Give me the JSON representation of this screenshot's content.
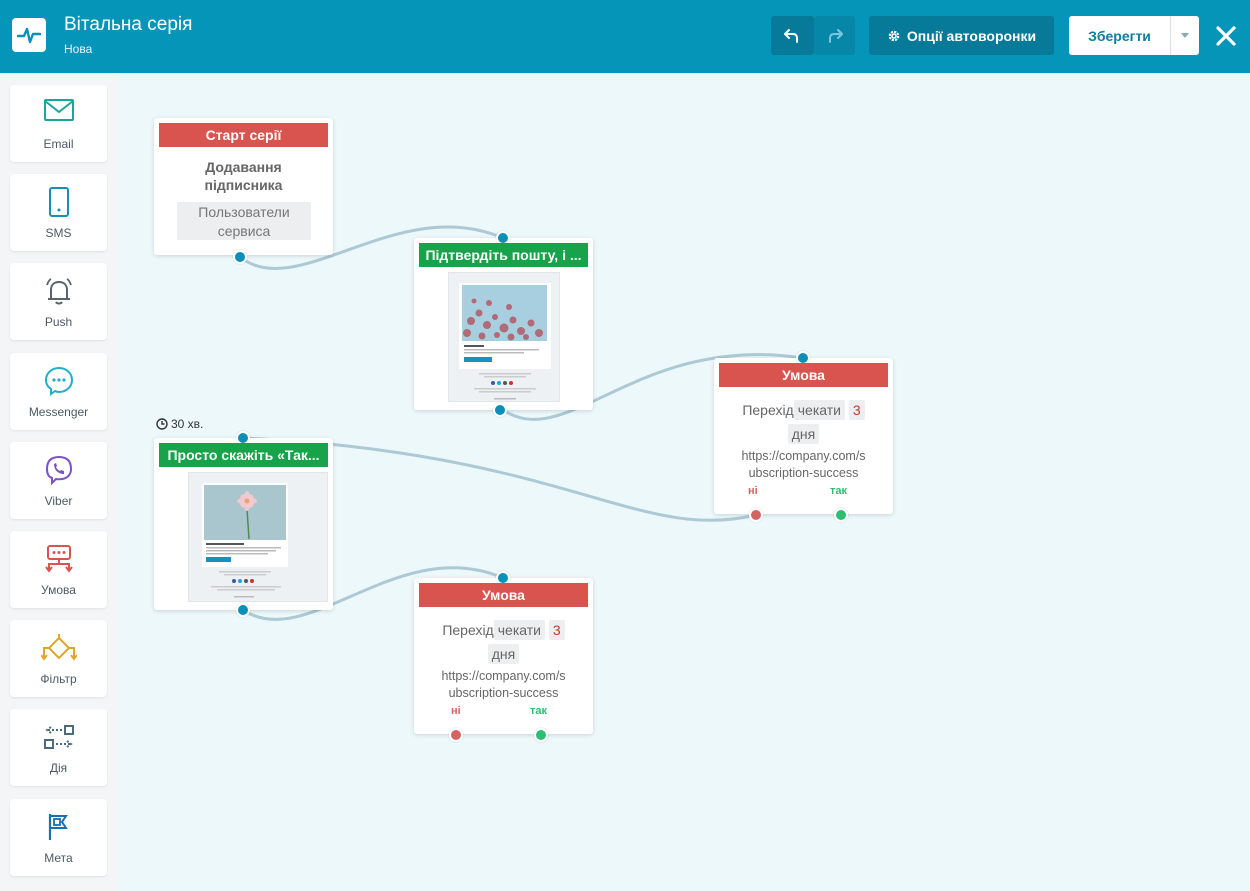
{
  "app": {
    "title": "Вітальна серія",
    "subtitle": "Нова"
  },
  "toolbar": {
    "options_label": "Опції автоворонки",
    "save_label": "Зберегти"
  },
  "sidebar": {
    "items": [
      {
        "label": "Email",
        "icon": "envelope-icon"
      },
      {
        "label": "SMS",
        "icon": "phone-icon"
      },
      {
        "label": "Push",
        "icon": "bell-icon"
      },
      {
        "label": "Messenger",
        "icon": "messenger-icon"
      },
      {
        "label": "Viber",
        "icon": "viber-icon"
      },
      {
        "label": "Умова",
        "icon": "condition-icon"
      },
      {
        "label": "Фільтр",
        "icon": "filter-icon"
      },
      {
        "label": "Дія",
        "icon": "action-icon"
      },
      {
        "label": "Мета",
        "icon": "goal-flag-icon"
      }
    ]
  },
  "nodes": {
    "start": {
      "header": "Старт серії",
      "title_line1": "Додавання",
      "title_line2": "підписника",
      "list_line1": "Пользователи",
      "list_line2": "сервиса"
    },
    "email_confirm": {
      "header": "Підтвердіть пошту, і ..."
    },
    "email_thanks": {
      "header": "Просто скажіть «Так...",
      "delay": "30 хв."
    },
    "condition_1": {
      "header": "Умова",
      "action": "Перехід",
      "wait_label": "чекати",
      "wait_value": "3",
      "wait_unit": "дня",
      "url_line1": "https://company.com/s",
      "url_line2": "ubscription-success",
      "no_label": "ні",
      "yes_label": "так"
    },
    "condition_2": {
      "header": "Умова",
      "action": "Перехід",
      "wait_label": "чекати",
      "wait_value": "3",
      "wait_unit": "дня",
      "url_line1": "https://company.com/s",
      "url_line2": "ubscription-success",
      "no_label": "ні",
      "yes_label": "так"
    }
  },
  "colors": {
    "header_bg": "#0595b9",
    "canvas_bg": "#ecf8fa",
    "node_red": "#d9534f",
    "node_green": "#16a34a",
    "port_blue": "#0b8fb8",
    "no_color": "#d46464",
    "yes_color": "#2cbf74"
  }
}
